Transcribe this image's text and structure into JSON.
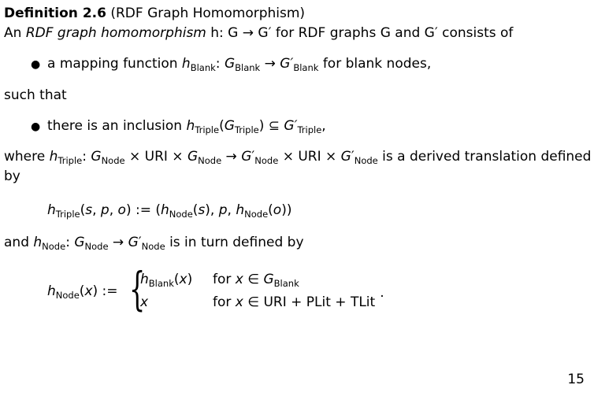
{
  "heading": {
    "label": "Definition 2.6",
    "subtitle": "(RDF Graph Homomorphism)"
  },
  "intro": {
    "prefix": "An ",
    "term": "RDF graph homomorphism",
    "middle": " h: G → G′ for RDF graphs G and G′ consists of"
  },
  "bullet1": {
    "prefix": "a mapping function ",
    "func": "h",
    "func_sub": "Blank",
    "colon": ": ",
    "dom": "G",
    "dom_sub": "Blank",
    "arrow": " → ",
    "cod": "G′",
    "cod_sub": "Blank",
    "suffix": " for blank nodes,"
  },
  "such_that": "such that",
  "bullet2": {
    "prefix": "there is an inclusion ",
    "func": "h",
    "func_sub": "Triple",
    "arg_open": "(",
    "arg": "G",
    "arg_sub": "Triple",
    "arg_close": ") ⊆ ",
    "target": "G′",
    "target_sub": "Triple",
    "suffix": ","
  },
  "where": {
    "line1": "where h_Triple: G_Node × URI × G_Node → G′_Node × URI × G′_Node is a derived translation defined",
    "line2": "by"
  },
  "formula1": "h_Triple(s, p, o) := (h_Node(s), p, h_Node(o))",
  "and_line": "and h_Node: G_Node → G′_Node is in turn defined by",
  "cases": {
    "lhs": "h_Node(x) :=",
    "row1_value": "h_Blank(x)",
    "row1_cond": "for x ∈ G_Blank",
    "row2_value": "x",
    "row2_cond": "for x ∈ URI + PLit + TLit",
    "trailing": "."
  },
  "page_number": "15"
}
